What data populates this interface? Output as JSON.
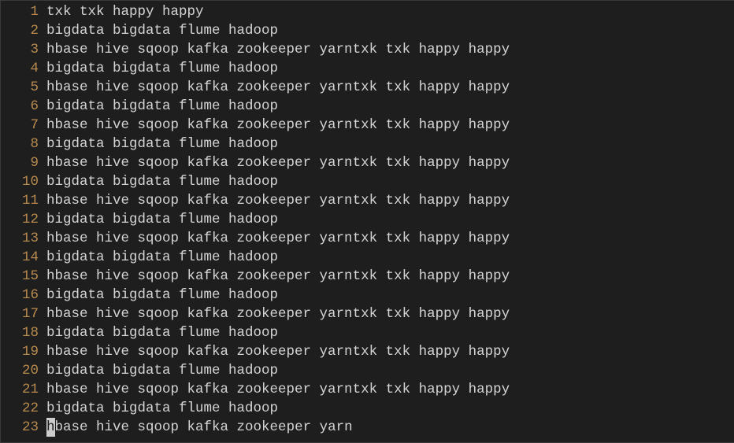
{
  "editor": {
    "lines": [
      {
        "num": "1",
        "text": "txk txk happy happy"
      },
      {
        "num": "2",
        "text": "bigdata bigdata flume hadoop"
      },
      {
        "num": "3",
        "text": "hbase hive sqoop kafka zookeeper yarntxk txk happy happy"
      },
      {
        "num": "4",
        "text": "bigdata bigdata flume hadoop"
      },
      {
        "num": "5",
        "text": "hbase hive sqoop kafka zookeeper yarntxk txk happy happy"
      },
      {
        "num": "6",
        "text": "bigdata bigdata flume hadoop"
      },
      {
        "num": "7",
        "text": "hbase hive sqoop kafka zookeeper yarntxk txk happy happy"
      },
      {
        "num": "8",
        "text": "bigdata bigdata flume hadoop"
      },
      {
        "num": "9",
        "text": "hbase hive sqoop kafka zookeeper yarntxk txk happy happy"
      },
      {
        "num": "10",
        "text": "bigdata bigdata flume hadoop"
      },
      {
        "num": "11",
        "text": "hbase hive sqoop kafka zookeeper yarntxk txk happy happy"
      },
      {
        "num": "12",
        "text": "bigdata bigdata flume hadoop"
      },
      {
        "num": "13",
        "text": "hbase hive sqoop kafka zookeeper yarntxk txk happy happy"
      },
      {
        "num": "14",
        "text": "bigdata bigdata flume hadoop"
      },
      {
        "num": "15",
        "text": "hbase hive sqoop kafka zookeeper yarntxk txk happy happy"
      },
      {
        "num": "16",
        "text": "bigdata bigdata flume hadoop"
      },
      {
        "num": "17",
        "text": "hbase hive sqoop kafka zookeeper yarntxk txk happy happy"
      },
      {
        "num": "18",
        "text": "bigdata bigdata flume hadoop"
      },
      {
        "num": "19",
        "text": "hbase hive sqoop kafka zookeeper yarntxk txk happy happy"
      },
      {
        "num": "20",
        "text": "bigdata bigdata flume hadoop"
      },
      {
        "num": "21",
        "text": "hbase hive sqoop kafka zookeeper yarntxk txk happy happy"
      },
      {
        "num": "22",
        "text": "bigdata bigdata flume hadoop"
      },
      {
        "num": "23",
        "text": "hbase hive sqoop kafka zookeeper yarn",
        "cursor_at": 0
      }
    ]
  }
}
